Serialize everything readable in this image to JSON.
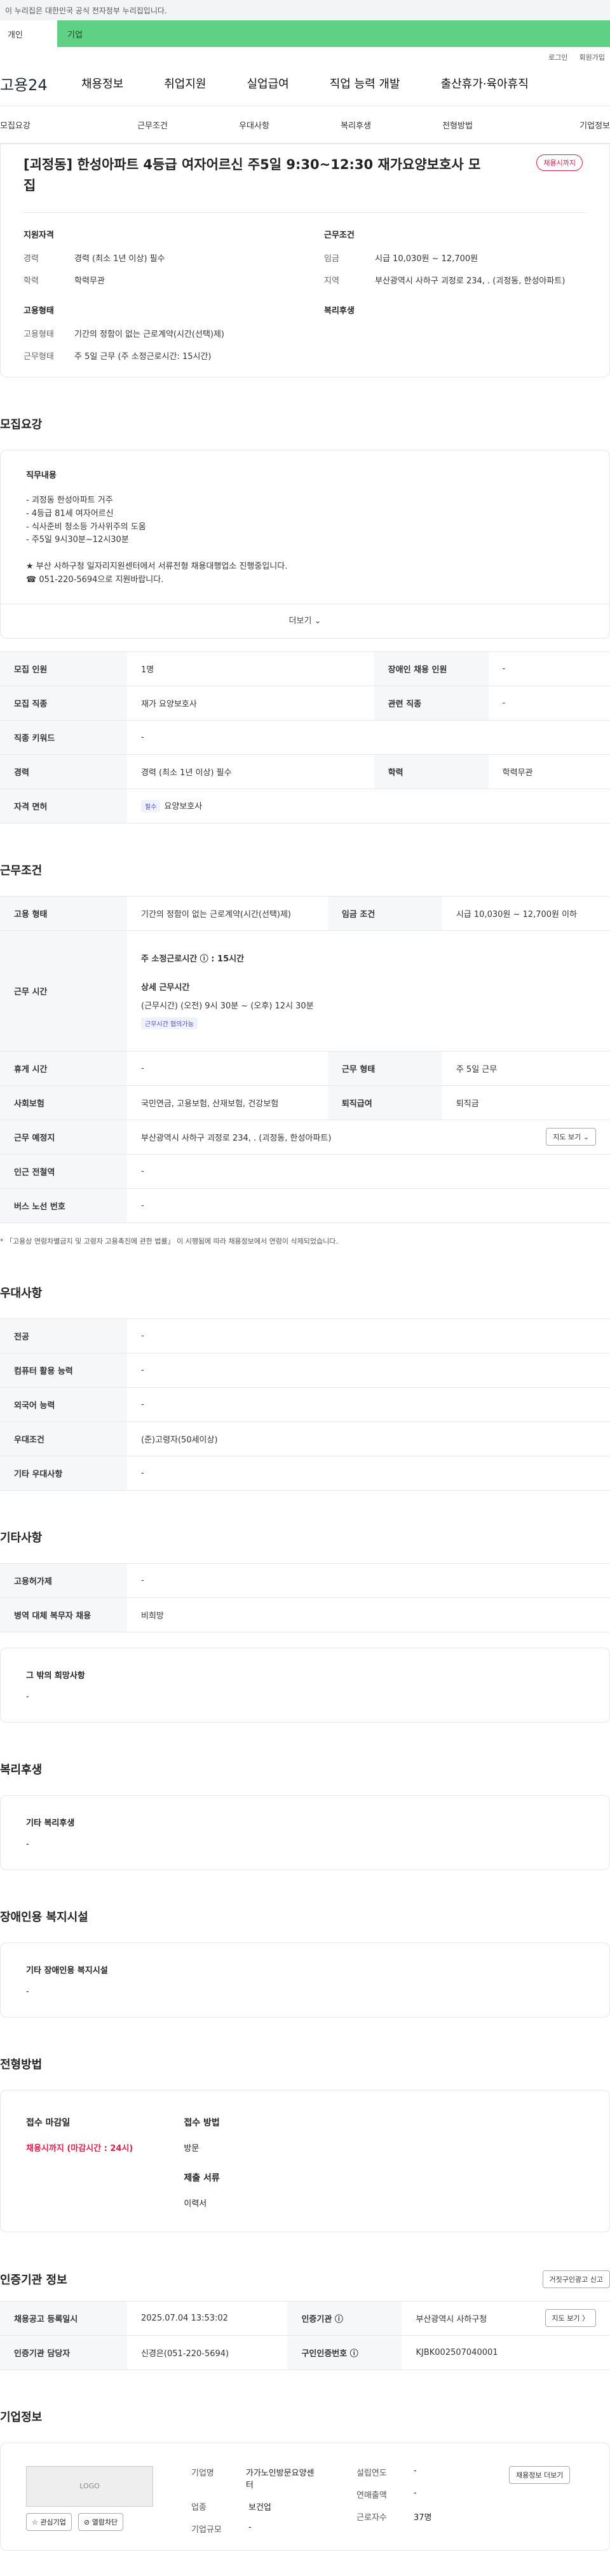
{
  "gov_bar": "이 누리집은 대한민국 공식 전자정부 누리집입니다.",
  "tabs": {
    "personal": "개인",
    "company": "기업"
  },
  "util": {
    "login": "로그인",
    "join": "회원가입"
  },
  "logo": "고용24",
  "gnb": [
    "채용정보",
    "취업지원",
    "실업급여",
    "직업 능력 개발",
    "출산휴가·육아휴직"
  ],
  "lnb": [
    "모집요강",
    "근무조건",
    "우대사항",
    "복리후생",
    "전형방법",
    "기업정보"
  ],
  "job": {
    "title": "[괴정동] 한성아파트 4등급 여자어르신 주5일 9:30~12:30 재가요양보호사 모집",
    "badge": "채용시까지",
    "req_head": "지원자격",
    "req": [
      {
        "k": "경력",
        "v": "경력 (최소 1년 이상) 필수"
      },
      {
        "k": "학력",
        "v": "학력무관"
      }
    ],
    "cond_head": "근무조건",
    "cond": [
      {
        "k": "임금",
        "v": "시급 10,030원 ~ 12,700원"
      },
      {
        "k": "지역",
        "v": "부산광역시 사하구 괴정로 234, . (괴정동, 한성아파트)"
      }
    ],
    "emp_head": "고용형태",
    "emp": [
      {
        "k": "고용형태",
        "v": "기간의 정함이 없는 근로계약(시간(선택)제)"
      },
      {
        "k": "근무형태",
        "v": "주 5일 근무 (주 소정근로시간: 15시간)"
      }
    ],
    "welfare_head": "복리후생"
  },
  "recruit": {
    "section": "모집요강",
    "duty_head": "직무내용",
    "duty_body": "- 괴정동 한성아파트 거주\n- 4등급 81세  여자어르신\n- 식사준비 청소등 가사위주의 도움\n- 주5일 9시30분~12시30분\n\n★ 부산 사하구청 일자리지원센터에서 서류전형 채용대행업소 진행중입니다.\n☎ 051-220-5694으로 지원바랍니다.",
    "more": "더보기 ⌄",
    "rows": [
      {
        "k1": "모집 인원",
        "v1": "1명",
        "k2": "장애인 채용 인원",
        "v2": "-"
      },
      {
        "k1": "모집 직종",
        "v1": "재가 요양보호사",
        "k2": "관련 직종",
        "v2": "-"
      },
      {
        "k1": "직종 키워드",
        "v1": "-"
      },
      {
        "k1": "경력",
        "v1": "경력 (최소 1년 이상) 필수",
        "k2": "학력",
        "v2": "학력무관"
      },
      {
        "k1": "자격 면허",
        "v1": "요양보호사",
        "pill": "필수"
      }
    ]
  },
  "work": {
    "section": "근무조건",
    "emp_type_k": "고용 형태",
    "emp_type_v": "기간의 정함이 없는 근로계약(시간(선택)제)",
    "wage_k": "임금 조건",
    "wage_v": "시급 10,030원 ~ 12,700원 이하",
    "hours_k": "근무 시간",
    "hours_week": "주 소정근로시간 ⓘ : 15시간",
    "hours_detail_h": "상세 근무시간",
    "hours_detail": "(근무시간) (오전) 9시 30분 ~ (오후) 12시 30분",
    "hours_pill": "근무시간 협의가능",
    "rows": [
      {
        "k1": "휴게 시간",
        "v1": "-",
        "k2": "근무 형태",
        "v2": "주 5일 근무"
      },
      {
        "k1": "사회보험",
        "v1": "국민연금, 고용보험, 산재보험, 건강보험",
        "k2": "퇴직급여",
        "v2": "퇴직금"
      }
    ],
    "place_k": "근무 예정지",
    "place_v": "부산광역시 사하구 괴정로 234, . (괴정동, 한성아파트)",
    "map_btn": "지도 보기 ⌄",
    "subway_k": "인근 전철역",
    "subway_v": "-",
    "bus_k": "버스 노선 번호",
    "bus_v": "-",
    "note": "* 「고용상 연령차별금지 및 고령자 고용촉진에 관한 법률」 이 시행됨에 따라 채용정보에서 연령이 삭제되었습니다."
  },
  "pref": {
    "section": "우대사항",
    "rows": [
      {
        "k": "전공",
        "v": "-"
      },
      {
        "k": "컴퓨터 활용 능력",
        "v": "-"
      },
      {
        "k": "외국어 능력",
        "v": "-"
      },
      {
        "k": "우대조건",
        "v": "(준)고령자(50세이상)"
      },
      {
        "k": "기타 우대사항",
        "v": "-"
      }
    ]
  },
  "etc": {
    "section": "기타사항",
    "rows": [
      {
        "k": "고용허가제",
        "v": "-"
      },
      {
        "k": "병역 대체 복무자 채용",
        "v": "비희망"
      }
    ],
    "other_h": "그 밖의 희망사항",
    "other_v": "-"
  },
  "welfare": {
    "section": "복리후생",
    "h": "기타 복리후생",
    "v": "-"
  },
  "disability": {
    "section": "장애인용 복지시설",
    "h": "기타 장애인용 복지시설",
    "v": "-"
  },
  "method": {
    "section": "전형방법",
    "deadline_h": "접수 마감일",
    "deadline_v": "채용시까지 (마감시간 : 24시)",
    "how_h": "접수 방법",
    "how_v": "방문",
    "docs_h": "제출 서류",
    "docs_v": "이력서"
  },
  "cert": {
    "section": "인증기관 정보",
    "report_btn": "거짓구인광고 신고",
    "reg_k": "채용공고 등록일시",
    "reg_v": "2025.07.04 13:53:02",
    "org_k": "인증기관 ⓘ",
    "org_v": "부산광역시 사하구청",
    "map_btn": "지도 보기 〉",
    "staff_k": "인증기관 담당자",
    "staff_v": "신경은(051-220-5694)",
    "auth_k": "구인인증번호 ⓘ",
    "auth_v": "KJBK002507040001"
  },
  "company": {
    "section": "기업정보",
    "logo_text": "LOGO",
    "fav_btn": "☆ 관심기업",
    "hide_btn": "⊘ 열람차단",
    "name_k": "기업명",
    "name_v": "가가노인방문요양센터",
    "industry_k": "업종",
    "industry_v": "보건업",
    "size_k": "기업규모",
    "size_v": "-",
    "year_k": "설립연도",
    "year_v": "-",
    "sales_k": "연매출액",
    "sales_v": "-",
    "staff_k": "근로자수",
    "staff_v": "37명",
    "jobs_btn": "채용정보 더보기"
  }
}
